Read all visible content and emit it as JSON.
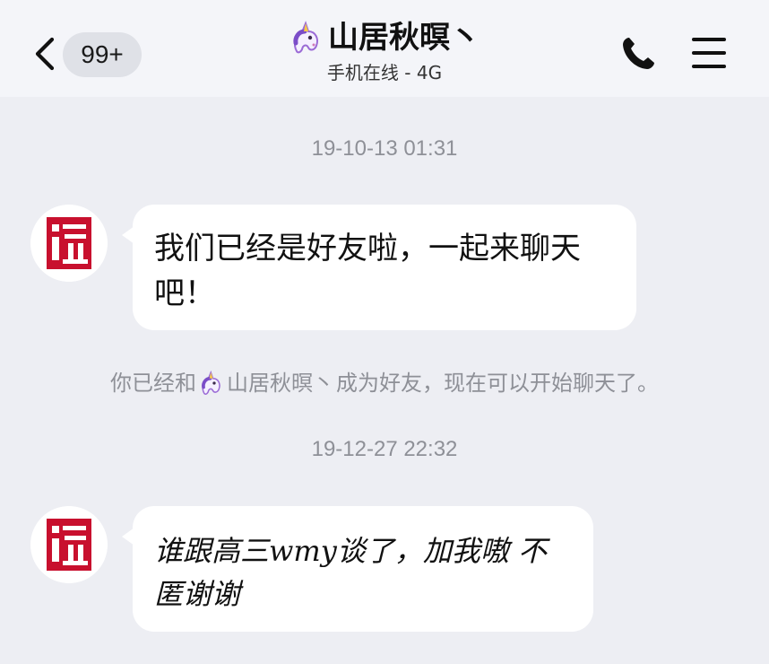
{
  "header": {
    "unread_count": "99+",
    "contact_name": "山居秋暝丶",
    "contact_status": "手机在线 - 4G"
  },
  "messages": [
    {
      "timestamp": "19-10-13 01:31",
      "text": "我们已经是好友啦，一起来聊天吧！"
    },
    {
      "timestamp": "19-12-27 22:32",
      "text": "谁跟高三wmy谈了，加我嗷 不匿谢谢"
    }
  ],
  "system_notice": {
    "prefix": "你已经和",
    "name": "山居秋暝丶",
    "suffix": "成为好友，现在可以开始聊天了。"
  },
  "colors": {
    "background": "#edeef3",
    "header": "#f4f5f9",
    "badge": "#dfe1e7",
    "avatar_red": "#c8102e"
  },
  "icons": {
    "back": "chevron-left-icon",
    "phone": "phone-icon",
    "menu": "hamburger-menu-icon",
    "emoji": "unicorn-emoji"
  }
}
